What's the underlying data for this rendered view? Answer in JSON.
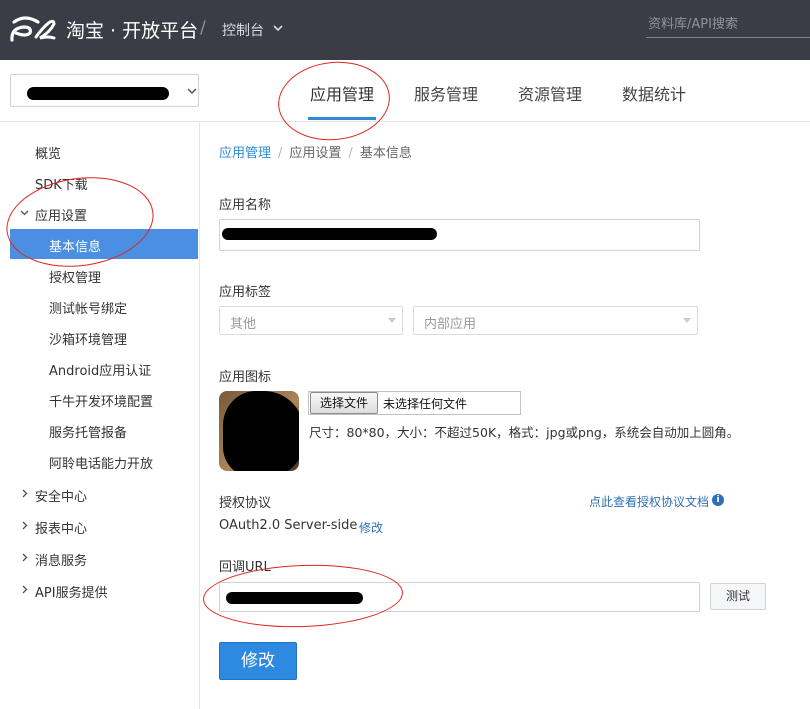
{
  "topbar": {
    "brand": "淘宝 · 开放平台",
    "slash": "/",
    "console_label": "控制台",
    "search_placeholder": "资料库/API搜索",
    "bg_color": "#3a3d45"
  },
  "main_nav": {
    "items": [
      {
        "label": "应用管理",
        "active": true
      },
      {
        "label": "服务管理",
        "active": false
      },
      {
        "label": "资源管理",
        "active": false
      },
      {
        "label": "数据统计",
        "active": false
      }
    ]
  },
  "sidebar": {
    "items": [
      {
        "label": "概览",
        "level": 1
      },
      {
        "label": "SDK下载",
        "level": 1
      },
      {
        "label": "应用设置",
        "level": 1,
        "expanded": true
      },
      {
        "label": "基本信息",
        "level": 2,
        "active": true
      },
      {
        "label": "授权管理",
        "level": 2
      },
      {
        "label": "测试帐号绑定",
        "level": 2
      },
      {
        "label": "沙箱环境管理",
        "level": 2
      },
      {
        "label": "Android应用认证",
        "level": 2
      },
      {
        "label": "千牛开发环境配置",
        "level": 2
      },
      {
        "label": "服务托管报备",
        "level": 2
      },
      {
        "label": "阿聆电话能力开放",
        "level": 2
      },
      {
        "label": "安全中心",
        "level": 1,
        "collapsed": true
      },
      {
        "label": "报表中心",
        "level": 1,
        "collapsed": true
      },
      {
        "label": "消息服务",
        "level": 1,
        "collapsed": true
      },
      {
        "label": "API服务提供",
        "level": 1,
        "collapsed": true
      }
    ],
    "active_color": "#4a8fe1"
  },
  "breadcrumb": {
    "items": [
      "应用管理",
      "应用设置",
      "基本信息"
    ],
    "separator": "/"
  },
  "form": {
    "app_name_label": "应用名称",
    "app_tag_label": "应用标签",
    "tag_select_1": "其他",
    "tag_select_2": "内部应用",
    "app_icon_label": "应用图标",
    "file_button": "选择文件",
    "file_none": "未选择任何文件",
    "icon_hint": "尺寸：80*80，大小：不超过50K，格式：jpg或png，系统会自动加上圆角。",
    "auth_label": "授权协议",
    "auth_doc_link": "点此查看授权协议文档",
    "auth_value": "OAuth2.0 Server-side",
    "auth_edit": "修改",
    "callback_label": "回调URL",
    "test_button": "测试",
    "submit_button": "修改"
  },
  "icons": {
    "info": "i"
  },
  "colors": {
    "accent": "#2f8ad8",
    "annotation": "#e0261e",
    "primary_button": "#2e8ae0"
  }
}
